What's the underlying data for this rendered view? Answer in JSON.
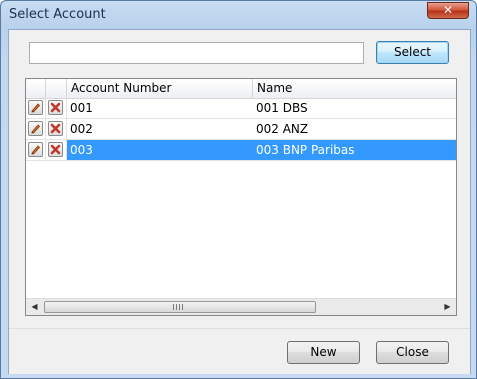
{
  "window": {
    "title": "Select Account",
    "close_glyph": "✕"
  },
  "search": {
    "value": "",
    "select_label": "Select"
  },
  "grid": {
    "columns": [
      "",
      "",
      "Account Number",
      "Name"
    ],
    "rows": [
      {
        "account_number": "001",
        "name": "001 DBS",
        "selected": false
      },
      {
        "account_number": "002",
        "name": "002 ANZ",
        "selected": false
      },
      {
        "account_number": "003",
        "name": "003 BNP Paribas",
        "selected": true
      }
    ],
    "icons": {
      "edit": "pencil-icon",
      "delete": "delete-x-icon"
    }
  },
  "footer": {
    "new_label": "New",
    "close_label": "Close"
  },
  "colors": {
    "selection": "#3399ff",
    "title_bar": "#b9d1ec",
    "close_button": "#c8452a"
  }
}
